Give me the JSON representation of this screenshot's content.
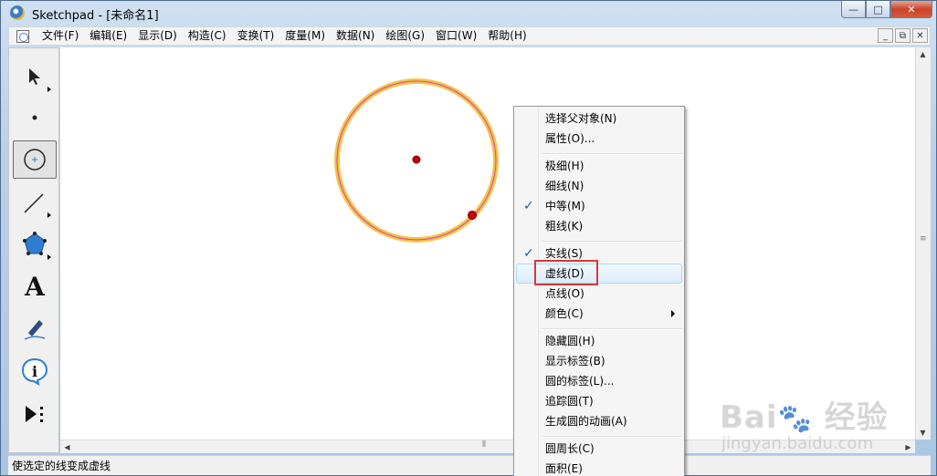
{
  "window": {
    "title": "Sketchpad  - [未命名1]",
    "caption_buttons": {
      "minimize": "—",
      "maximize": "□",
      "close": "✕"
    }
  },
  "menubar": {
    "items": [
      "文件(F)",
      "编辑(E)",
      "显示(D)",
      "构造(C)",
      "变换(T)",
      "度量(M)",
      "数据(N)",
      "绘图(G)",
      "窗口(W)",
      "帮助(H)"
    ],
    "mdi_buttons": {
      "minimize": "_",
      "restore": "⧉",
      "close": "✕"
    }
  },
  "toolbox": {
    "tools": [
      {
        "name": "arrow-tool",
        "icon": "arrow-icon",
        "active": false
      },
      {
        "name": "point-tool",
        "icon": "point-icon",
        "active": false
      },
      {
        "name": "compass-tool",
        "icon": "compass-icon",
        "active": true
      },
      {
        "name": "line-tool",
        "icon": "line-icon",
        "active": false
      },
      {
        "name": "polygon-tool",
        "icon": "polygon-icon",
        "active": false
      },
      {
        "name": "text-tool",
        "icon": "text-icon",
        "label": "A",
        "active": false
      },
      {
        "name": "marker-tool",
        "icon": "marker-icon",
        "active": false
      },
      {
        "name": "info-tool",
        "icon": "info-icon",
        "label": "i",
        "active": false
      },
      {
        "name": "custom-tool",
        "icon": "custom-tool-icon",
        "active": false
      }
    ]
  },
  "canvas": {
    "circle": {
      "stroke": "#d63cc8",
      "highlight": "#f4c542",
      "point_color": "#cc0000"
    }
  },
  "context_menu": {
    "items": [
      {
        "label": "选择父对象(N)"
      },
      {
        "label": "属性(O)..."
      },
      {
        "label": "极细(H)"
      },
      {
        "label": "细线(N)"
      },
      {
        "label": "中等(M)",
        "checked": true
      },
      {
        "label": "粗线(K)"
      },
      {
        "label": "实线(S)",
        "checked": true
      },
      {
        "label": "虚线(D)",
        "highlighted": true
      },
      {
        "label": "点线(O)"
      },
      {
        "label": "颜色(C)",
        "submenu": true
      },
      {
        "label": "隐藏圆(H)"
      },
      {
        "label": "显示标签(B)"
      },
      {
        "label": "圆的标签(L)..."
      },
      {
        "label": "追踪圆(T)"
      },
      {
        "label": "生成圆的动画(A)"
      },
      {
        "label": "圆周长(C)"
      },
      {
        "label": "面积(E)"
      }
    ],
    "check_glyph": "✓"
  },
  "statusbar": {
    "text": "使选定的线变成虚线"
  },
  "watermark": {
    "logo": "Bai du 经验",
    "url": "jingyan.baidu.com"
  }
}
